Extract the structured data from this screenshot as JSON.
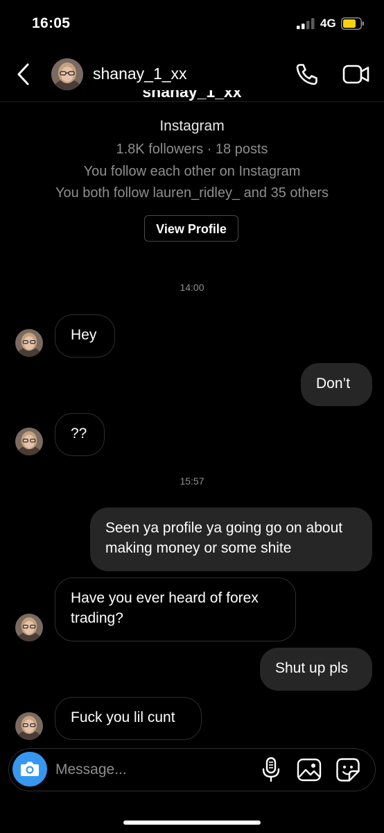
{
  "status_bar": {
    "time": "16:05",
    "network": "4G"
  },
  "header": {
    "username": "shanay_1_xx"
  },
  "profile": {
    "name": "shanay_1_xx",
    "platform": "Instagram",
    "stats": "1.8K followers · 18 posts",
    "mutual_follow": "You follow each other on Instagram",
    "mutual_friends": "You both follow lauren_ridley_ and 35 others",
    "view_profile_label": "View Profile"
  },
  "messages": [
    {
      "type": "timestamp",
      "text": "14:00"
    },
    {
      "type": "incoming",
      "text": "Hey"
    },
    {
      "type": "outgoing",
      "text": "Don’t"
    },
    {
      "type": "incoming",
      "text": "??"
    },
    {
      "type": "timestamp",
      "text": "15:57"
    },
    {
      "type": "outgoing",
      "text": "Seen ya profile ya going go on about making money or some shite"
    },
    {
      "type": "incoming",
      "text": "Have you ever heard of forex trading?"
    },
    {
      "type": "outgoing",
      "text": "Shut up pls"
    },
    {
      "type": "incoming",
      "text": "Fuck you lil cunt"
    }
  ],
  "composer": {
    "placeholder": "Message..."
  },
  "icons": {
    "back": "chevron-left-icon",
    "call": "phone-icon",
    "video": "video-camera-icon",
    "camera": "camera-icon",
    "mic": "microphone-icon",
    "gallery": "image-icon",
    "sticker": "sticker-icon"
  },
  "colors": {
    "background": "#000000",
    "incoming_border": "#2e2e2e",
    "outgoing_bubble": "#262626",
    "secondary_text": "#8e8e8e",
    "camera_button": "#3797f0",
    "battery": "#f5d20a"
  }
}
